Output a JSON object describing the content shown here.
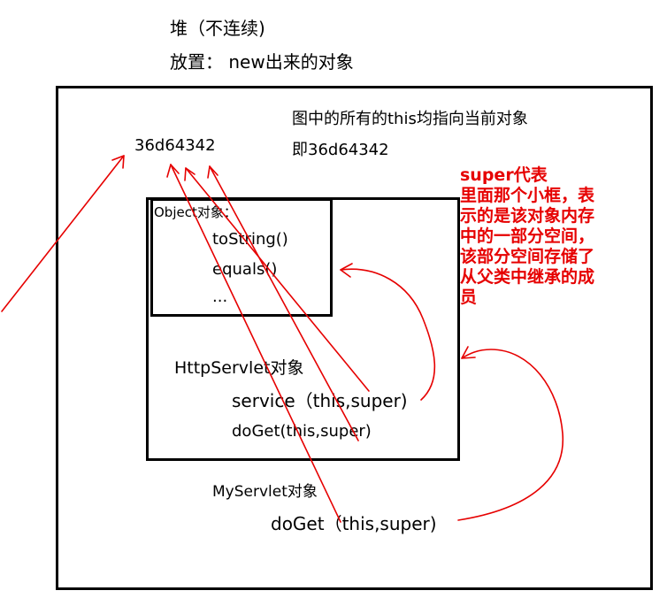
{
  "header": {
    "heap_title": "堆（不连续)",
    "storage_line": "放置：  new出来的对象"
  },
  "heap": {
    "this_note_line1": "图中的所有的this均指向当前对象",
    "this_note_line2": "即36d64342",
    "address": "36d64342"
  },
  "super_note": {
    "lines": [
      "super代表",
      "里面那个小框，表",
      "示的是该对象内存",
      "中的一部分空间，",
      "该部分空间存储了",
      "从父类中继承的成",
      "员"
    ]
  },
  "object_box": {
    "title": "Object对象：",
    "methods": [
      "toString()",
      "equals()",
      "..."
    ]
  },
  "httpservlet_box": {
    "title": "HttpServlet对象",
    "methods": [
      "service（this,super)",
      "doGet(this,super)"
    ]
  },
  "myservlet": {
    "title": "MyServlet对象",
    "method": "doGet（this,super)"
  },
  "colors": {
    "annotation": "#e60000",
    "box_border": "#000000",
    "text": "#000000"
  }
}
